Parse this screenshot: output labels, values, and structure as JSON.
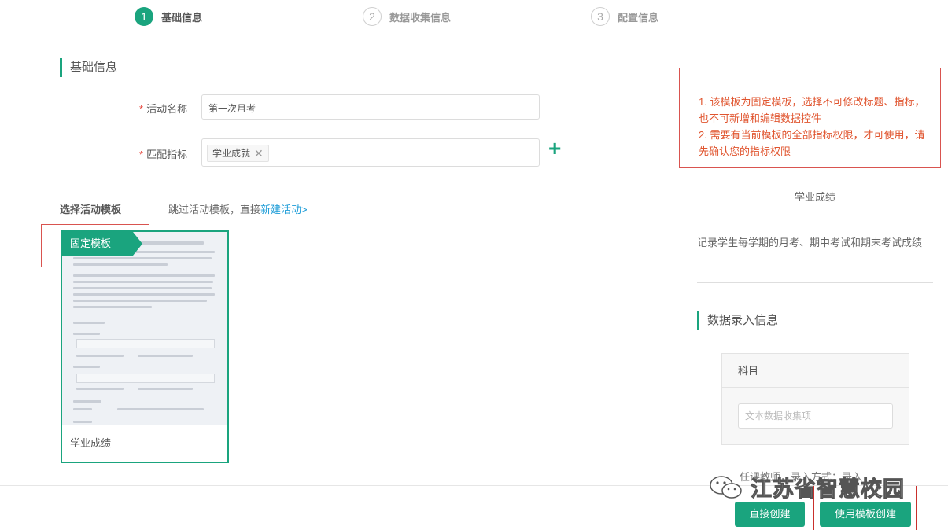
{
  "steps": [
    {
      "num": "1",
      "label": "基础信息",
      "active": true
    },
    {
      "num": "2",
      "label": "数据收集信息",
      "active": false
    },
    {
      "num": "3",
      "label": "配置信息",
      "active": false
    }
  ],
  "basic_section": {
    "title": "基础信息",
    "activity_name_label": "活动名称",
    "activity_name_value": "第一次月考",
    "indicator_label": "匹配指标",
    "indicator_tag": "学业成就",
    "required_mark": "*",
    "tag_remove": "✕",
    "add_icon": "+"
  },
  "template_select": {
    "label": "选择活动模板",
    "skip_prefix": "跳过活动模板，直接",
    "skip_link": "新建活动>",
    "card_badge": "固定模板",
    "card_name": "学业成绩"
  },
  "right_panel": {
    "notice_line1": "1. 该模板为固定模板，选择不可修改标题、指标，也不可新增和编辑数据控件",
    "notice_line2": "2. 需要有当前模板的全部指标权限，才可使用，请先确认您的指标权限",
    "title": "学业成绩",
    "description": "记录学生每学期的月考、期中考试和期末考试成绩",
    "data_section_title": "数据录入信息",
    "subject_label": "科目",
    "subject_placeholder": "文本数据收集项",
    "cut_text": "任课教师，录入方式：录入"
  },
  "watermark": "江苏省智慧校园",
  "buttons": {
    "direct_create": "直接创建",
    "template_create": "使用模板创建"
  },
  "colors": {
    "accent": "#1aa47e",
    "notice_text": "#e0542e",
    "link": "#1a9bd7"
  }
}
